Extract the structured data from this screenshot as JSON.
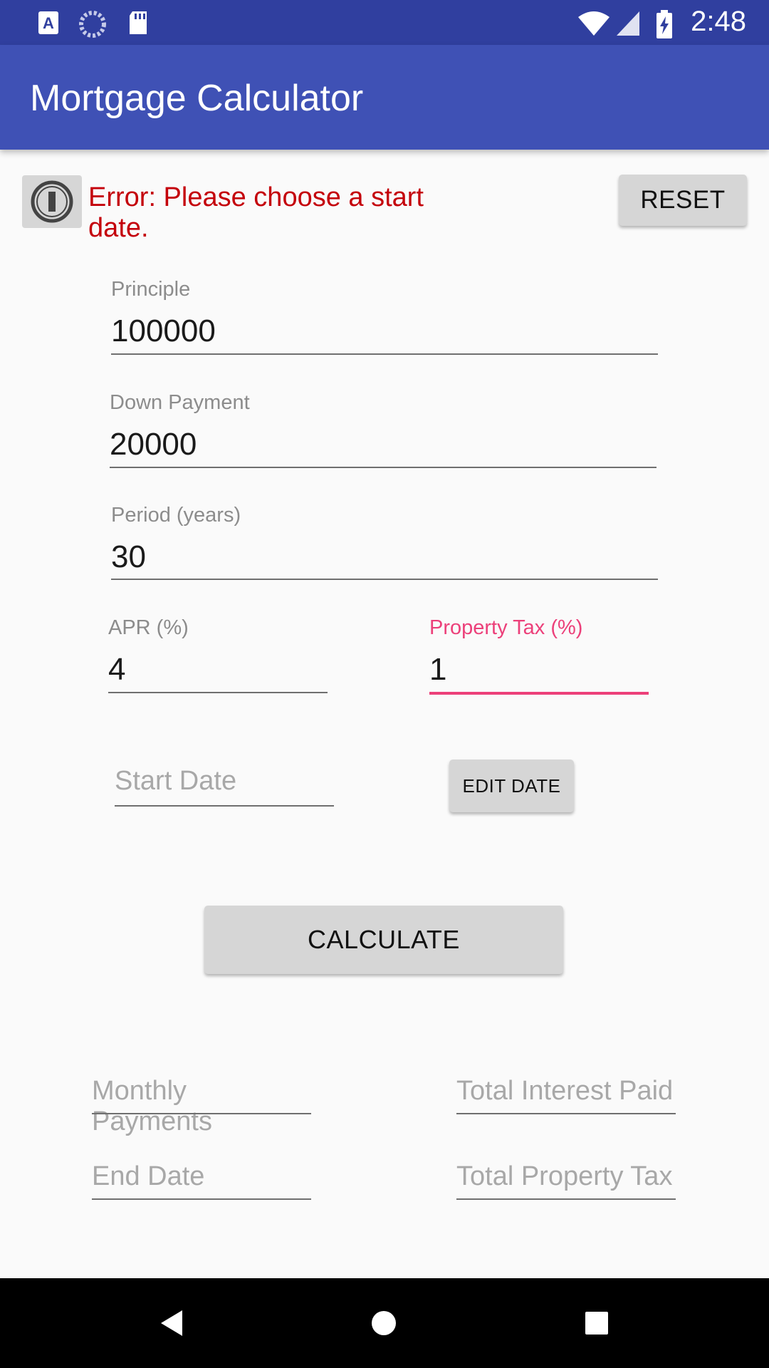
{
  "status_bar": {
    "time": "2:48",
    "icons_left": [
      "a-notification-icon",
      "sync-circle-icon",
      "sd-card-icon"
    ],
    "icons_right": [
      "wifi-icon",
      "cell-signal-icon",
      "battery-charging-icon"
    ]
  },
  "app_bar": {
    "title": "Mortgage Calculator"
  },
  "error_message": "Error: Please choose a start date.",
  "buttons": {
    "reset": "RESET",
    "edit_date": "EDIT DATE",
    "calculate": "CALCULATE"
  },
  "fields": {
    "principle": {
      "label": "Principle",
      "value": "100000"
    },
    "down_payment": {
      "label": "Down Payment",
      "value": "20000"
    },
    "period": {
      "label": "Period (years)",
      "value": "30"
    },
    "apr": {
      "label": "APR (%)",
      "value": "4"
    },
    "property_tax": {
      "label": "Property Tax (%)",
      "value": "1"
    },
    "start_date": {
      "hint": "Start Date"
    }
  },
  "results": {
    "monthly_payments": "Monthly Payments",
    "total_interest_paid": "Total Interest Paid",
    "end_date": "End Date",
    "total_property_tax": "Total Property Tax"
  },
  "colors": {
    "status_bar": "#303f9f",
    "app_bar": "#3f51b5",
    "error": "#c4000a",
    "focus_accent": "#ec407a"
  }
}
